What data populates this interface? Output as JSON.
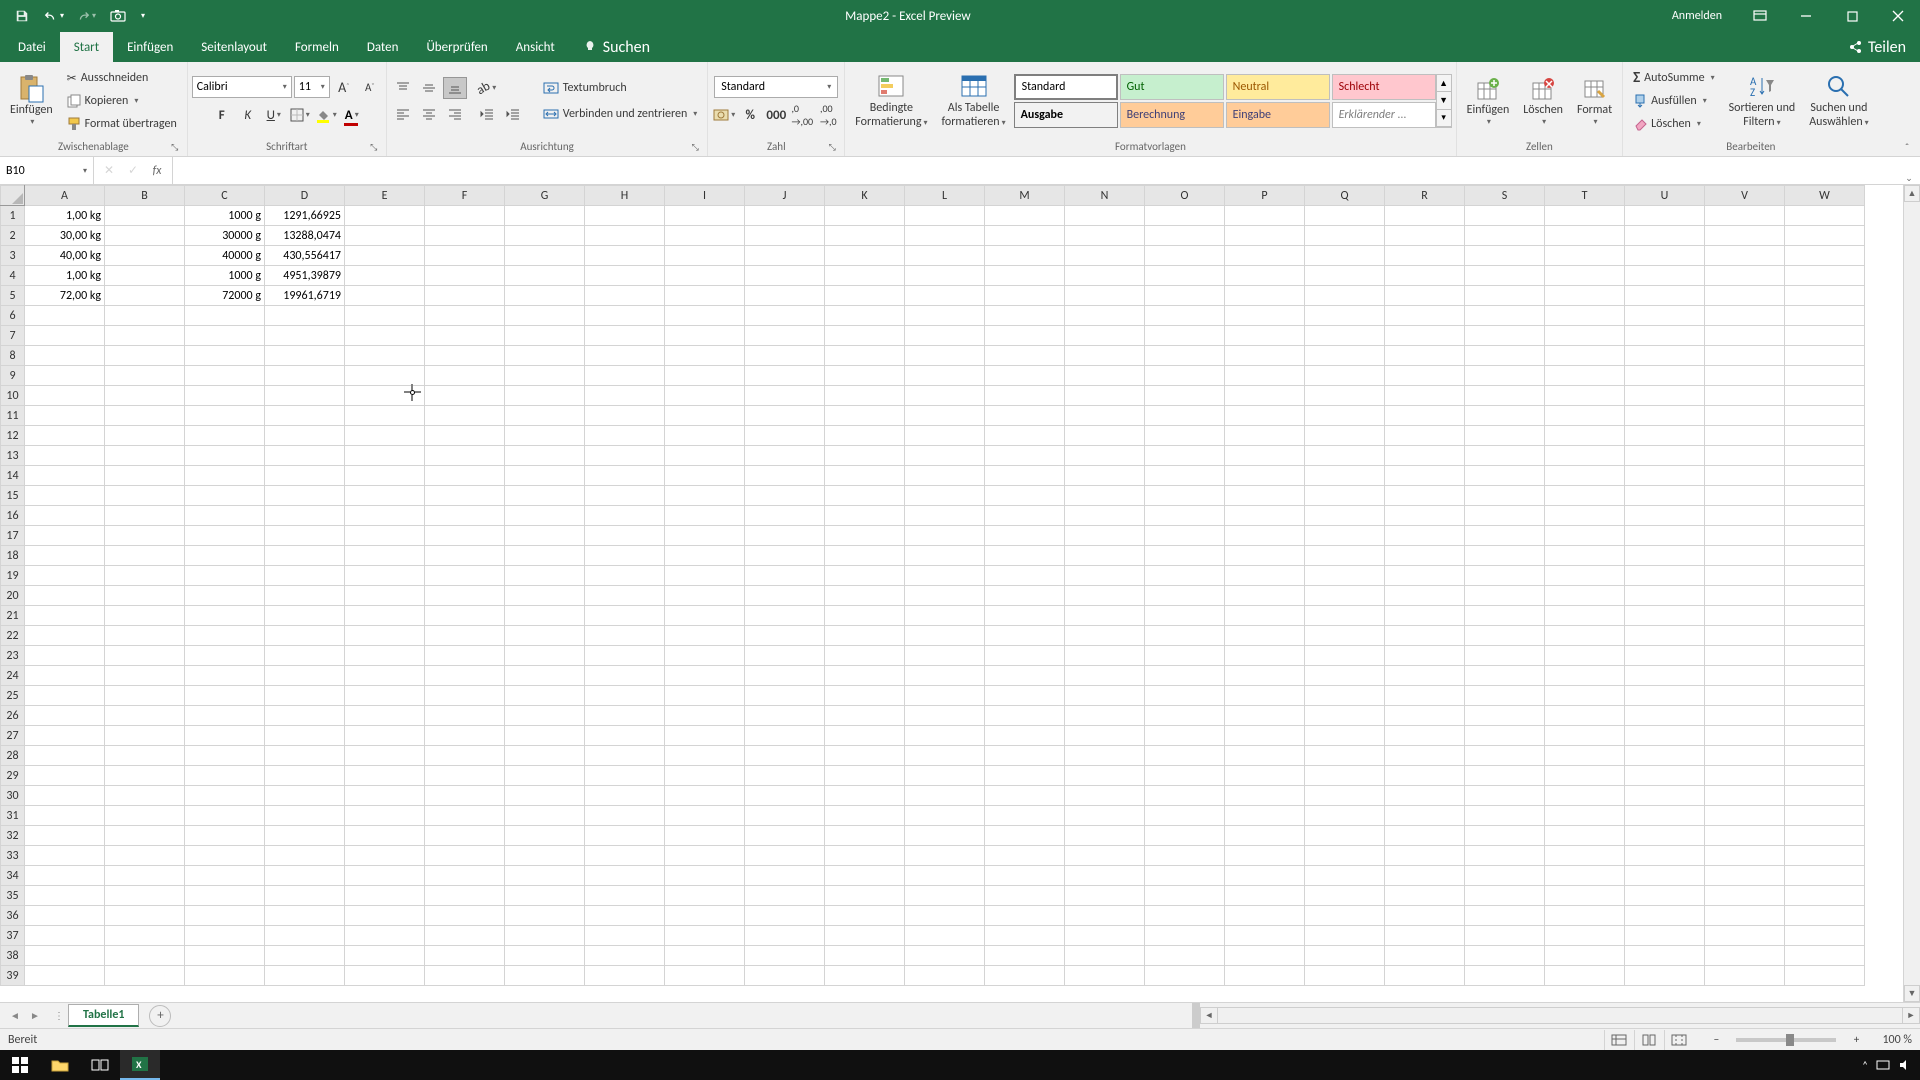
{
  "title": "Mappe2 - Excel Preview",
  "signin": "Anmelden",
  "menu_tabs": [
    "Datei",
    "Start",
    "Einfügen",
    "Seitenlayout",
    "Formeln",
    "Daten",
    "Überprüfen",
    "Ansicht"
  ],
  "search": "Suchen",
  "share": "Teilen",
  "clipboard": {
    "paste": "Einfügen",
    "cut": "Ausschneiden",
    "copy": "Kopieren",
    "format_painter": "Format übertragen",
    "group": "Zwischenablage"
  },
  "font": {
    "name": "Calibri",
    "size": "11",
    "group": "Schriftart"
  },
  "alignment": {
    "wrap": "Textumbruch",
    "merge": "Verbinden und zentrieren",
    "group": "Ausrichtung"
  },
  "number": {
    "format": "Standard",
    "group": "Zahl"
  },
  "styles": {
    "cond": "Bedingte Formatierung",
    "cond1": "Bedingte",
    "cond2": "Formatierung",
    "table": "Als Tabelle formatieren",
    "table1": "Als Tabelle",
    "table2": "formatieren",
    "s1": "Standard",
    "s2": "Gut",
    "s3": "Neutral",
    "s4": "Schlecht",
    "s5": "Ausgabe",
    "s6": "Berechnung",
    "s7": "Eingabe",
    "s8": "Erklärender ...",
    "group": "Formatvorlagen"
  },
  "cells": {
    "insert": "Einfügen",
    "delete": "Löschen",
    "format": "Format",
    "group": "Zellen"
  },
  "editing": {
    "sum": "AutoSumme",
    "fill": "Ausfüllen",
    "clear": "Löschen",
    "sort": "Sortieren und Filtern",
    "sort1": "Sortieren und",
    "sort2": "Filtern",
    "find": "Suchen und Auswählen",
    "find1": "Suchen und",
    "find2": "Auswählen",
    "group": "Bearbeiten"
  },
  "namebox": "B10",
  "formula": "",
  "columns": [
    "A",
    "B",
    "C",
    "D",
    "E",
    "F",
    "G",
    "H",
    "I",
    "J",
    "K",
    "L",
    "M",
    "N",
    "O",
    "P",
    "Q",
    "R",
    "S",
    "T",
    "U",
    "V",
    "W"
  ],
  "cell_data": {
    "A1": "1,00 kg",
    "C1": "1000 g",
    "D1": "1291,66925",
    "A2": "30,00 kg",
    "C2": "30000 g",
    "D2": "13288,0474",
    "A3": "40,00 kg",
    "C3": "40000 g",
    "D3": "430,556417",
    "A4": "1,00 kg",
    "C4": "1000 g",
    "D4": "4951,39879",
    "A5": "72,00 kg",
    "C5": "72000 g",
    "D5": "19961,6719"
  },
  "row_count": 39,
  "sheet_tab": "Tabelle1",
  "status": "Bereit",
  "zoom": "100 %"
}
